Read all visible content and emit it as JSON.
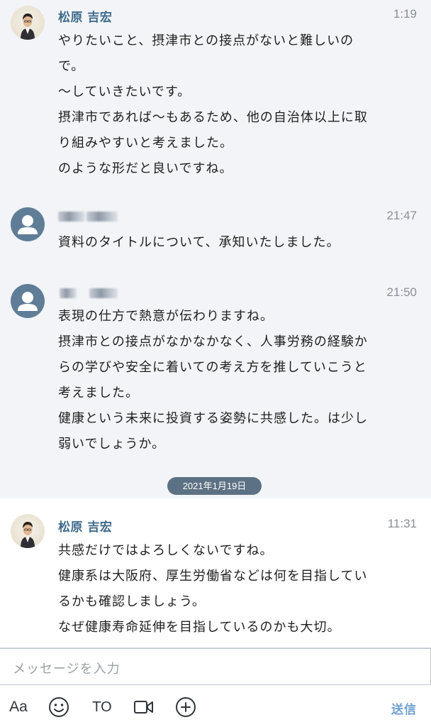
{
  "messages": [
    {
      "sender": "松原 吉宏",
      "time": "1:19",
      "lines": [
        "やりたいこと、摂津市との接点がないと難しいの",
        "で。",
        "〜していきたいです。",
        "摂津市であれば〜もあるため、他の自治体以上に取",
        "り組みやすいと考えました。",
        "のような形だと良いですね。"
      ]
    },
    {
      "sender": "",
      "time": "21:47",
      "lines": [
        "資料のタイトルについて、承知いたしました。"
      ]
    },
    {
      "sender": "",
      "time": "21:50",
      "lines": [
        "表現の仕方で熱意が伝わりますね。",
        "摂津市との接点がなかなかなく、人事労務の経験か",
        "らの学びや安全に着いての考え方を推していこうと",
        "考えました。",
        "健康という未来に投資する姿勢に共感した。は少し",
        "弱いでしょうか。"
      ]
    },
    {
      "sender": "松原 吉宏",
      "time": "11:31",
      "lines": [
        "共感だけではよろしくないですね。",
        "健康系は大阪府、厚生労働省などは何を目指してい",
        "るかも確認しましょう。",
        "なぜ健康寿命延伸を目指しているのかも大切。"
      ]
    }
  ],
  "date_divider": "2021年1月19日",
  "composer": {
    "placeholder": "メッセージを入力",
    "font_label": "Aa",
    "to_label": "TO",
    "send_label": "送信"
  },
  "icons": {
    "emoji": "smiley-icon",
    "video": "video-icon",
    "add": "plus-circle-icon"
  },
  "colors": {
    "sender_name": "#3e6a8b",
    "date_pill": "#5d7184",
    "send": "#6f9fd0",
    "default_avatar": "#5f7d96"
  }
}
